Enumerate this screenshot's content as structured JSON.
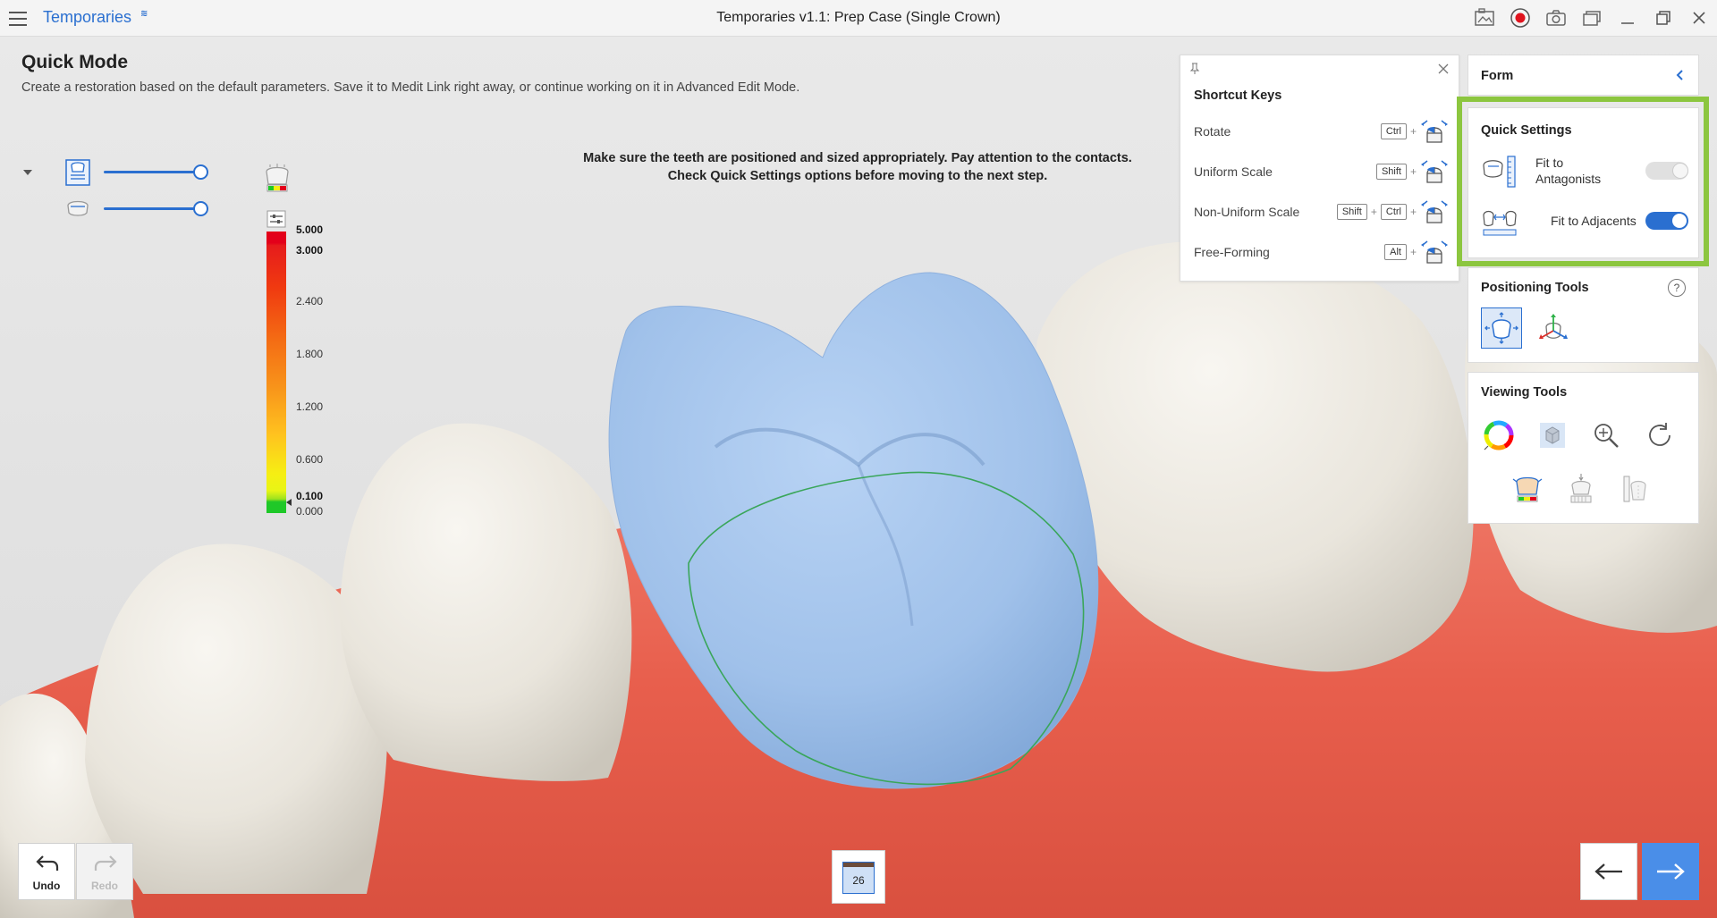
{
  "titlebar": {
    "app_name": "Temporaries",
    "app_badge": "≋",
    "window_title": "Temporaries v1.1: Prep Case (Single Crown)",
    "icons": [
      "screenshot-gallery-icon",
      "record-icon",
      "camera-icon",
      "window-switch-icon",
      "minimize-icon",
      "maximize-icon",
      "close-icon"
    ]
  },
  "header": {
    "title": "Quick Mode",
    "description": "Create a restoration based on the default parameters. Save it to Medit Link right away, or continue working on it in Advanced Edit Mode."
  },
  "instruction": {
    "line1": "Make sure the teeth are positioned and sized appropriately. Pay attention to the contacts.",
    "line2": "Check Quick Settings options before moving to the next step."
  },
  "object_list": {
    "items": [
      {
        "icon": "restoration-data-icon",
        "opacity": 1.0
      },
      {
        "icon": "scan-data-icon",
        "opacity": 1.0
      }
    ]
  },
  "legend": {
    "labels": [
      "5.000",
      "3.000",
      "2.400",
      "1.800",
      "1.200",
      "0.600",
      "0.100",
      "0.000"
    ],
    "colors": {
      "high": "#e3001a",
      "mid": "#f8931a",
      "low": "#f6ee13",
      "zero": "#1ec828"
    }
  },
  "shortcut_keys": {
    "title": "Shortcut Keys",
    "rows": [
      {
        "label": "Rotate",
        "keys": [
          "Ctrl"
        ]
      },
      {
        "label": "Uniform Scale",
        "keys": [
          "Shift"
        ]
      },
      {
        "label": "Non-Uniform Scale",
        "keys": [
          "Shift",
          "Ctrl"
        ]
      },
      {
        "label": "Free-Forming",
        "keys": [
          "Alt"
        ]
      }
    ]
  },
  "form_panel": {
    "title": "Form"
  },
  "quick_settings": {
    "title": "Quick Settings",
    "fit_to_antagonists": {
      "label_line1": "Fit to",
      "label_line2": "Antagonists",
      "enabled": false
    },
    "fit_to_adjacents": {
      "label": "Fit to Adjacents",
      "enabled": true
    }
  },
  "positioning_tools": {
    "title": "Positioning Tools",
    "help": "?"
  },
  "viewing_tools": {
    "title": "Viewing Tools"
  },
  "bottom": {
    "undo_label": "Undo",
    "redo_label": "Redo",
    "tooth_number": "26"
  },
  "colors": {
    "accent": "#2a6fd0",
    "highlight": "#8cc63f",
    "crown": "#a6c6ee",
    "gum": "#e96a59",
    "tooth": "#ece8e0"
  }
}
